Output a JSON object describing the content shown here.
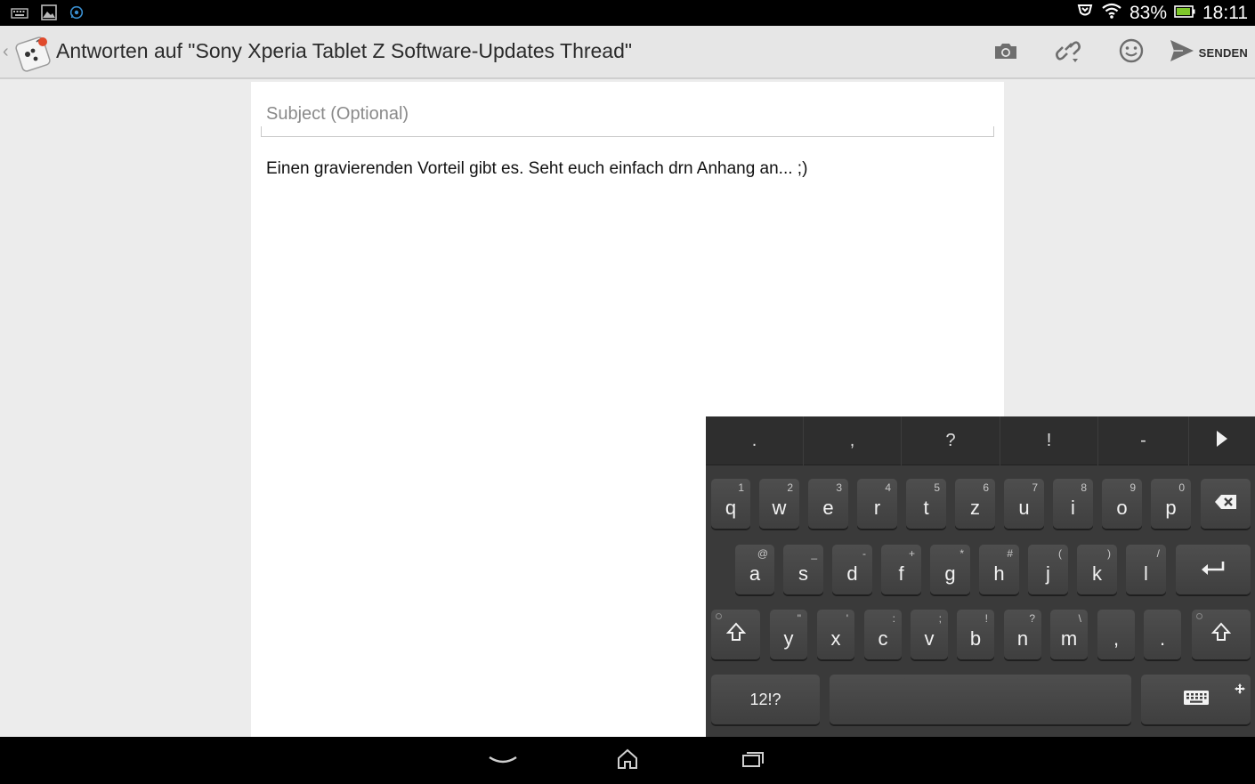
{
  "status_bar": {
    "battery_percent": "83%",
    "time": "18:11",
    "left_icons": [
      "keyboard-icon",
      "gallery-icon",
      "whatsapp-icon"
    ],
    "right_icons": [
      "transfer-icon",
      "wifi-icon",
      "battery-icon"
    ],
    "battery_color": "#7ec82a"
  },
  "action_bar": {
    "title": "Antworten auf \"Sony Xperia Tablet Z Software-Updates Thread\"",
    "send_label": "SENDEN",
    "actions": [
      "camera-icon",
      "link-icon",
      "smiley-icon",
      "send-icon"
    ]
  },
  "editor": {
    "subject_placeholder": "Subject (Optional)",
    "subject_value": "",
    "body_text": "Einen gravierenden Vorteil gibt es. Seht euch einfach drn Anhang an... ;)"
  },
  "keyboard": {
    "suggestions": [
      ".",
      ",",
      "?",
      "!",
      "-"
    ],
    "row1": [
      {
        "k": "q",
        "s": "1"
      },
      {
        "k": "w",
        "s": "2"
      },
      {
        "k": "e",
        "s": "3"
      },
      {
        "k": "r",
        "s": "4"
      },
      {
        "k": "t",
        "s": "5"
      },
      {
        "k": "z",
        "s": "6"
      },
      {
        "k": "u",
        "s": "7"
      },
      {
        "k": "i",
        "s": "8"
      },
      {
        "k": "o",
        "s": "9"
      },
      {
        "k": "p",
        "s": "0"
      }
    ],
    "row2": [
      {
        "k": "a",
        "s": "@"
      },
      {
        "k": "s",
        "s": "_"
      },
      {
        "k": "d",
        "s": "-"
      },
      {
        "k": "f",
        "s": "+"
      },
      {
        "k": "g",
        "s": "*"
      },
      {
        "k": "h",
        "s": "#"
      },
      {
        "k": "j",
        "s": "("
      },
      {
        "k": "k",
        "s": ")"
      },
      {
        "k": "l",
        "s": "/"
      }
    ],
    "row3": [
      {
        "k": "y",
        "s": "\""
      },
      {
        "k": "x",
        "s": "'"
      },
      {
        "k": "c",
        "s": ":"
      },
      {
        "k": "v",
        "s": ";"
      },
      {
        "k": "b",
        "s": "!"
      },
      {
        "k": "n",
        "s": "?"
      },
      {
        "k": "m",
        "s": "\\"
      },
      {
        "k": ",",
        "s": ""
      },
      {
        "k": ".",
        "s": ""
      }
    ],
    "symbols_label": "12!?"
  },
  "nav_bar": {
    "buttons": [
      "back-icon",
      "home-icon",
      "recent-apps-icon"
    ]
  }
}
